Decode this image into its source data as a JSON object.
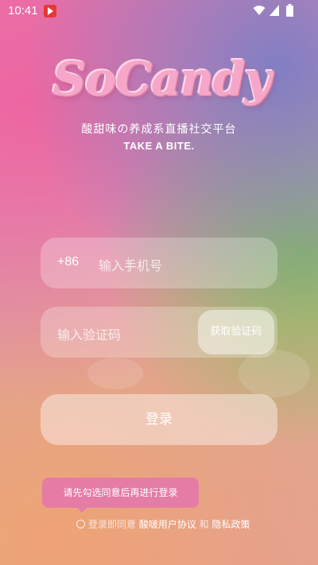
{
  "status_bar": {
    "time": "10:41",
    "icons": [
      "app-notification-icon",
      "wifi-icon",
      "signal-icon",
      "battery-icon"
    ]
  },
  "app": {
    "logo_text": "SoCandy",
    "tagline_cn": "酸甜味の养成系直播社交平台",
    "tagline_en": "TAKE A BITE."
  },
  "phone_field": {
    "country_code": "+86",
    "placeholder": "输入手机号"
  },
  "code_field": {
    "placeholder": "输入验证码",
    "get_code_label": "获取验证码"
  },
  "login_button": {
    "label": "登录"
  },
  "toast": {
    "text": "请先勾选同意后再进行登录"
  },
  "agreement": {
    "prefix": "登录即同意",
    "user_agreement": "酸啵用户协议",
    "and": "和",
    "privacy_policy": "隐私政策"
  },
  "colors": {
    "accent_pink": "#e47ca6",
    "logo_pink": "#f6a6c8"
  }
}
